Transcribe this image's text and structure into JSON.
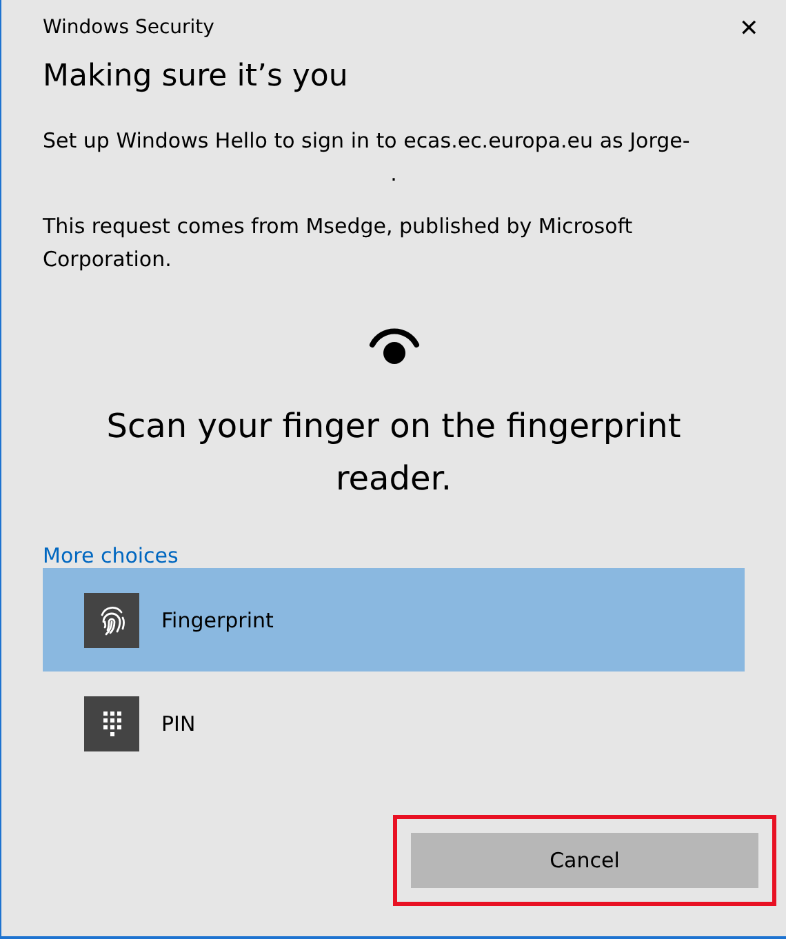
{
  "window": {
    "title": "Windows Security",
    "close": "✕"
  },
  "heading": "Making sure it’s you",
  "message": [
    "Set up Windows Hello to sign in to ecas.ec.europa.eu as Jorge-",
    "."
  ],
  "source": "This request comes from Msedge, published by Microsoft Corporation.",
  "prompt": "Scan your finger on the fingerprint reader.",
  "more_choices": "More choices",
  "options": [
    {
      "kind": "fingerprint",
      "label": "Fingerprint",
      "selected": true
    },
    {
      "kind": "pin",
      "label": "PIN",
      "selected": false
    }
  ],
  "cancel": {
    "label": "Cancel",
    "highlighted": true
  }
}
